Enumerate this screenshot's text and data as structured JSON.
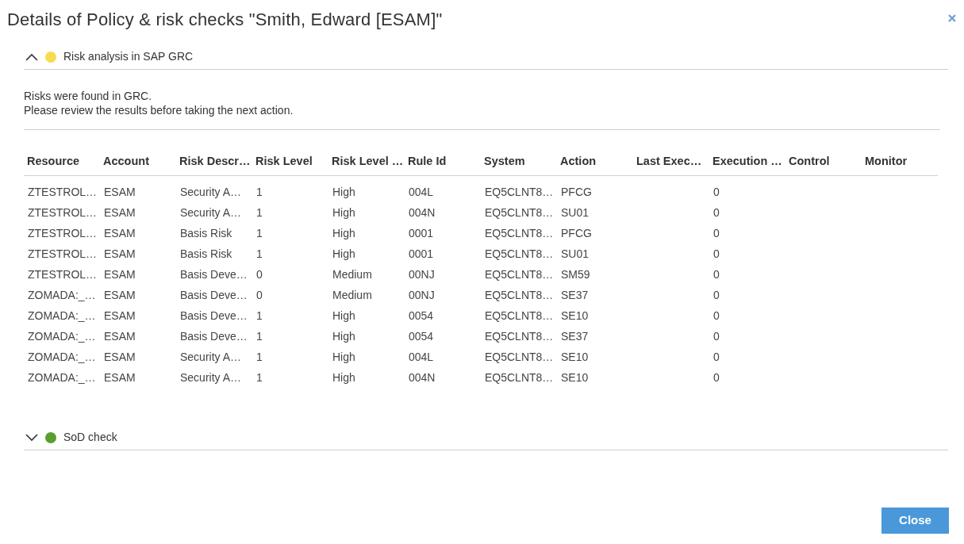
{
  "dialog": {
    "title": "Details of Policy & risk checks \"Smith, Edward [ESAM]\""
  },
  "sections": [
    {
      "title": "Risk analysis in SAP GRC",
      "expanded": true,
      "color": "#f7dc4f",
      "message": [
        "Risks were found in GRC.",
        "Please review the results before taking the next action."
      ],
      "table": {
        "columns": [
          "Resource",
          "Account",
          "Risk Descr…",
          "Risk Level",
          "Risk Level …",
          "Rule Id",
          "System",
          "Action",
          "Last Exec…",
          "Execution …",
          "Control",
          "Monitor"
        ],
        "rows": [
          [
            "ZTESTROL…",
            "ESAM",
            "Security A…",
            "1",
            "High",
            "004L",
            "EQ5CLNT8…",
            "PFCG",
            "",
            "0",
            "",
            ""
          ],
          [
            "ZTESTROL…",
            "ESAM",
            "Security A…",
            "1",
            "High",
            "004N",
            "EQ5CLNT8…",
            "SU01",
            "",
            "0",
            "",
            ""
          ],
          [
            "ZTESTROL…",
            "ESAM",
            "Basis Risk",
            "1",
            "High",
            "0001",
            "EQ5CLNT8…",
            "PFCG",
            "",
            "0",
            "",
            ""
          ],
          [
            "ZTESTROL…",
            "ESAM",
            "Basis Risk",
            "1",
            "High",
            "0001",
            "EQ5CLNT8…",
            "SU01",
            "",
            "0",
            "",
            ""
          ],
          [
            "ZTESTROL…",
            "ESAM",
            "Basis Deve…",
            "0",
            "Medium",
            "00NJ",
            "EQ5CLNT8…",
            "SM59",
            "",
            "0",
            "",
            ""
          ],
          [
            "ZOMADA:_…",
            "ESAM",
            "Basis Deve…",
            "0",
            "Medium",
            "00NJ",
            "EQ5CLNT8…",
            "SE37",
            "",
            "0",
            "",
            ""
          ],
          [
            "ZOMADA:_…",
            "ESAM",
            "Basis Deve…",
            "1",
            "High",
            "0054",
            "EQ5CLNT8…",
            "SE10",
            "",
            "0",
            "",
            ""
          ],
          [
            "ZOMADA:_…",
            "ESAM",
            "Basis Deve…",
            "1",
            "High",
            "0054",
            "EQ5CLNT8…",
            "SE37",
            "",
            "0",
            "",
            ""
          ],
          [
            "ZOMADA:_…",
            "ESAM",
            "Security A…",
            "1",
            "High",
            "004L",
            "EQ5CLNT8…",
            "SE10",
            "",
            "0",
            "",
            ""
          ],
          [
            "ZOMADA:_…",
            "ESAM",
            "Security A…",
            "1",
            "High",
            "004N",
            "EQ5CLNT8…",
            "SE10",
            "",
            "0",
            "",
            ""
          ]
        ]
      }
    },
    {
      "title": "SoD check",
      "expanded": false,
      "color": "#5a9e32"
    }
  ],
  "buttons": [
    "Close"
  ]
}
